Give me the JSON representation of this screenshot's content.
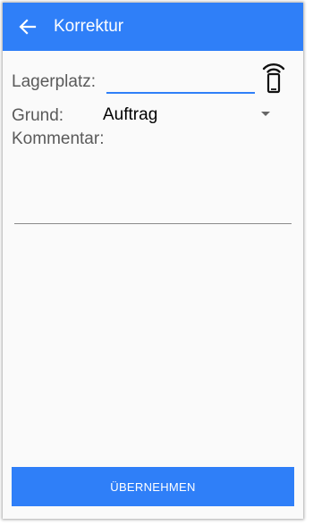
{
  "appbar": {
    "title": "Korrektur",
    "back_icon": "arrow-left-icon",
    "background_color": "#2f7ff8"
  },
  "form": {
    "lagerplatz_label": "Lagerplatz:",
    "lagerplatz_value": "",
    "scan_icon": "nfc-phone-icon",
    "grund_label": "Grund:",
    "grund_selected": "Auftrag",
    "kommentar_label": "Kommentar:",
    "kommentar_value": ""
  },
  "actions": {
    "submit_label": "ÜBERNEHMEN",
    "accent_color": "#2f7ff8"
  }
}
